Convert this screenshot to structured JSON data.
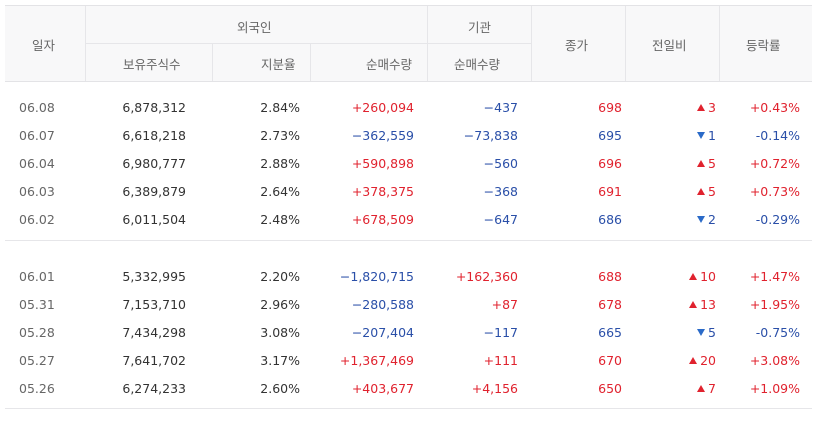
{
  "headers": {
    "date": "일자",
    "foreign": "외국인",
    "foreign_hold": "보유주식수",
    "foreign_ratio": "지분율",
    "foreign_net": "순매수량",
    "inst": "기관",
    "inst_net": "순매수량",
    "close": "종가",
    "change": "전일비",
    "rate": "등락률"
  },
  "colors": {
    "up": "#e0222e",
    "down": "#2a4fa8"
  },
  "groups": [
    {
      "rows": [
        {
          "date": "06.08",
          "hold": "6,878,312",
          "ratio": "2.84%",
          "fnet": "+260,094",
          "fnet_dir": "up",
          "inet": "−437",
          "inet_dir": "down",
          "close": "698",
          "close_dir": "up",
          "chg_dir": "up",
          "chg": "3",
          "rate": "+0.43%"
        },
        {
          "date": "06.07",
          "hold": "6,618,218",
          "ratio": "2.73%",
          "fnet": "−362,559",
          "fnet_dir": "down",
          "inet": "−73,838",
          "inet_dir": "down",
          "close": "695",
          "close_dir": "down",
          "chg_dir": "down",
          "chg": "1",
          "rate": "-0.14%"
        },
        {
          "date": "06.04",
          "hold": "6,980,777",
          "ratio": "2.88%",
          "fnet": "+590,898",
          "fnet_dir": "up",
          "inet": "−560",
          "inet_dir": "down",
          "close": "696",
          "close_dir": "up",
          "chg_dir": "up",
          "chg": "5",
          "rate": "+0.72%"
        },
        {
          "date": "06.03",
          "hold": "6,389,879",
          "ratio": "2.64%",
          "fnet": "+378,375",
          "fnet_dir": "up",
          "inet": "−368",
          "inet_dir": "down",
          "close": "691",
          "close_dir": "up",
          "chg_dir": "up",
          "chg": "5",
          "rate": "+0.73%"
        },
        {
          "date": "06.02",
          "hold": "6,011,504",
          "ratio": "2.48%",
          "fnet": "+678,509",
          "fnet_dir": "up",
          "inet": "−647",
          "inet_dir": "down",
          "close": "686",
          "close_dir": "down",
          "chg_dir": "down",
          "chg": "2",
          "rate": "-0.29%"
        }
      ]
    },
    {
      "rows": [
        {
          "date": "06.01",
          "hold": "5,332,995",
          "ratio": "2.20%",
          "fnet": "−1,820,715",
          "fnet_dir": "down",
          "inet": "+162,360",
          "inet_dir": "up",
          "close": "688",
          "close_dir": "up",
          "chg_dir": "up",
          "chg": "10",
          "rate": "+1.47%"
        },
        {
          "date": "05.31",
          "hold": "7,153,710",
          "ratio": "2.96%",
          "fnet": "−280,588",
          "fnet_dir": "down",
          "inet": "+87",
          "inet_dir": "up",
          "close": "678",
          "close_dir": "up",
          "chg_dir": "up",
          "chg": "13",
          "rate": "+1.95%"
        },
        {
          "date": "05.28",
          "hold": "7,434,298",
          "ratio": "3.08%",
          "fnet": "−207,404",
          "fnet_dir": "down",
          "inet": "−117",
          "inet_dir": "down",
          "close": "665",
          "close_dir": "down",
          "chg_dir": "down",
          "chg": "5",
          "rate": "-0.75%"
        },
        {
          "date": "05.27",
          "hold": "7,641,702",
          "ratio": "3.17%",
          "fnet": "+1,367,469",
          "fnet_dir": "up",
          "inet": "+111",
          "inet_dir": "up",
          "close": "670",
          "close_dir": "up",
          "chg_dir": "up",
          "chg": "20",
          "rate": "+3.08%"
        },
        {
          "date": "05.26",
          "hold": "6,274,233",
          "ratio": "2.60%",
          "fnet": "+403,677",
          "fnet_dir": "up",
          "inet": "+4,156",
          "inet_dir": "up",
          "close": "650",
          "close_dir": "up",
          "chg_dir": "up",
          "chg": "7",
          "rate": "+1.09%"
        }
      ]
    }
  ]
}
